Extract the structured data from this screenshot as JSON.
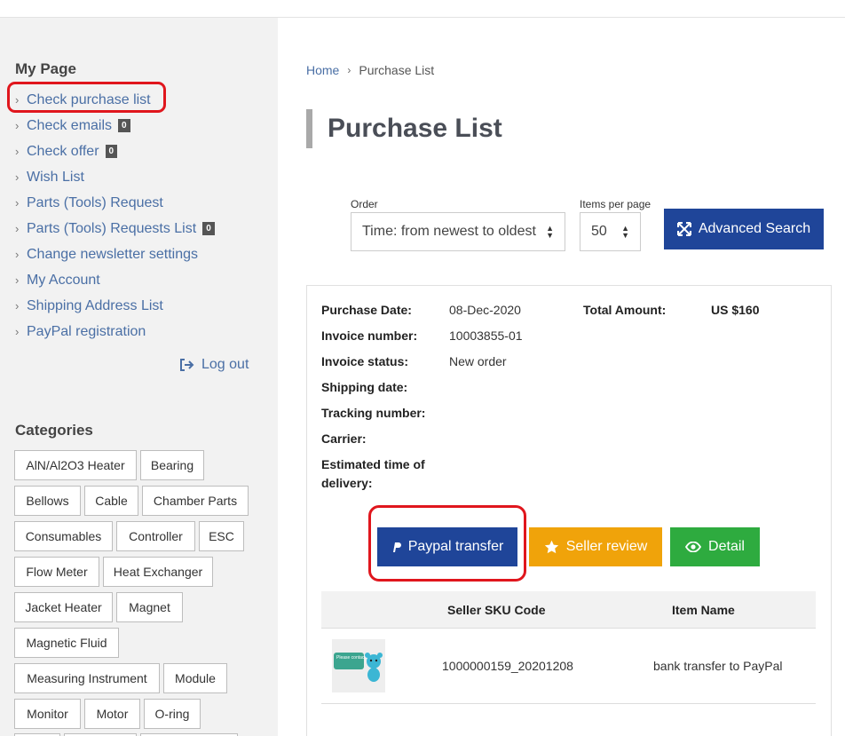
{
  "sidebar": {
    "mypage_title": "My Page",
    "menu": [
      {
        "label": "Check purchase list"
      },
      {
        "label": "Check emails",
        "badge": "0"
      },
      {
        "label": "Check offer",
        "badge": "0"
      },
      {
        "label": "Wish List"
      },
      {
        "label": "Parts (Tools) Request"
      },
      {
        "label": "Parts (Tools) Requests List",
        "badge": "0"
      },
      {
        "label": "Change newsletter settings"
      },
      {
        "label": "My Account"
      },
      {
        "label": "Shipping Address List"
      },
      {
        "label": "PayPal registration"
      }
    ],
    "logout": "Log out",
    "categories_title": "Categories",
    "categories": [
      "AlN/Al2O3 Heater",
      "Bearing",
      "Bellows",
      "Cable",
      "Chamber Parts",
      "Consumables",
      "Controller",
      "ESC",
      "Flow Meter",
      "Heat Exchanger",
      "Jacket Heater",
      "Magnet",
      "Magnetic Fluid",
      "Measuring Instrument",
      "Module",
      "Monitor",
      "Motor",
      "O-ring"
    ]
  },
  "breadcrumb": {
    "home": "Home",
    "separator": "›",
    "current": "Purchase List"
  },
  "page_title": "Purchase List",
  "filters": {
    "order_label": "Order",
    "order_value": "Time: from newest to oldest",
    "per_page_label": "Items per page",
    "per_page_value": "50",
    "advanced_search": "Advanced Search"
  },
  "order": {
    "purchase_date_label": "Purchase Date:",
    "purchase_date": "08-Dec-2020",
    "total_amount_label": "Total Amount:",
    "total_amount": "US $160",
    "invoice_number_label": "Invoice number:",
    "invoice_number": "10003855-01",
    "invoice_status_label": "Invoice status:",
    "invoice_status": "New order",
    "shipping_date_label": "Shipping date:",
    "tracking_number_label": "Tracking number:",
    "carrier_label": "Carrier:",
    "eta_label_1": "Estimated time of",
    "eta_label_2": "delivery:"
  },
  "actions": {
    "paypal": "Paypal transfer",
    "review": "Seller review",
    "detail": "Detail"
  },
  "table": {
    "headers": {
      "sku": "Seller SKU Code",
      "item": "Item Name"
    },
    "rows": [
      {
        "sku": "1000000159_20201208",
        "item": "bank transfer to PayPal",
        "thumb_text": "Please contact seller"
      }
    ]
  },
  "colors": {
    "primary": "#1f4599",
    "review": "#f0a30a",
    "detail": "#2eab3f",
    "highlight": "#e0161d",
    "link": "#4a6fa5"
  }
}
